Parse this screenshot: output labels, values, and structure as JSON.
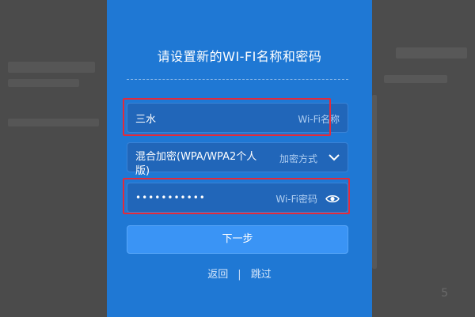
{
  "dialog": {
    "title": "请设置新的WI-FI名称和密码"
  },
  "wifi_name": {
    "value": "三水",
    "placeholder": "Wi-Fi名称"
  },
  "encryption": {
    "value": "混合加密(WPA/WPA2个人版)",
    "hint": "加密方式"
  },
  "wifi_password": {
    "value": "•••••••••••",
    "placeholder": "Wi-Fi密码"
  },
  "actions": {
    "next_label": "下一步",
    "back_label": "返回",
    "separator": "|",
    "skip_label": "跳过"
  },
  "background": {
    "corner_number": "5"
  },
  "colors": {
    "panel": "#1f78d4",
    "field": "#2166b9",
    "button": "#3a94f5",
    "highlight": "#e32b3b"
  }
}
